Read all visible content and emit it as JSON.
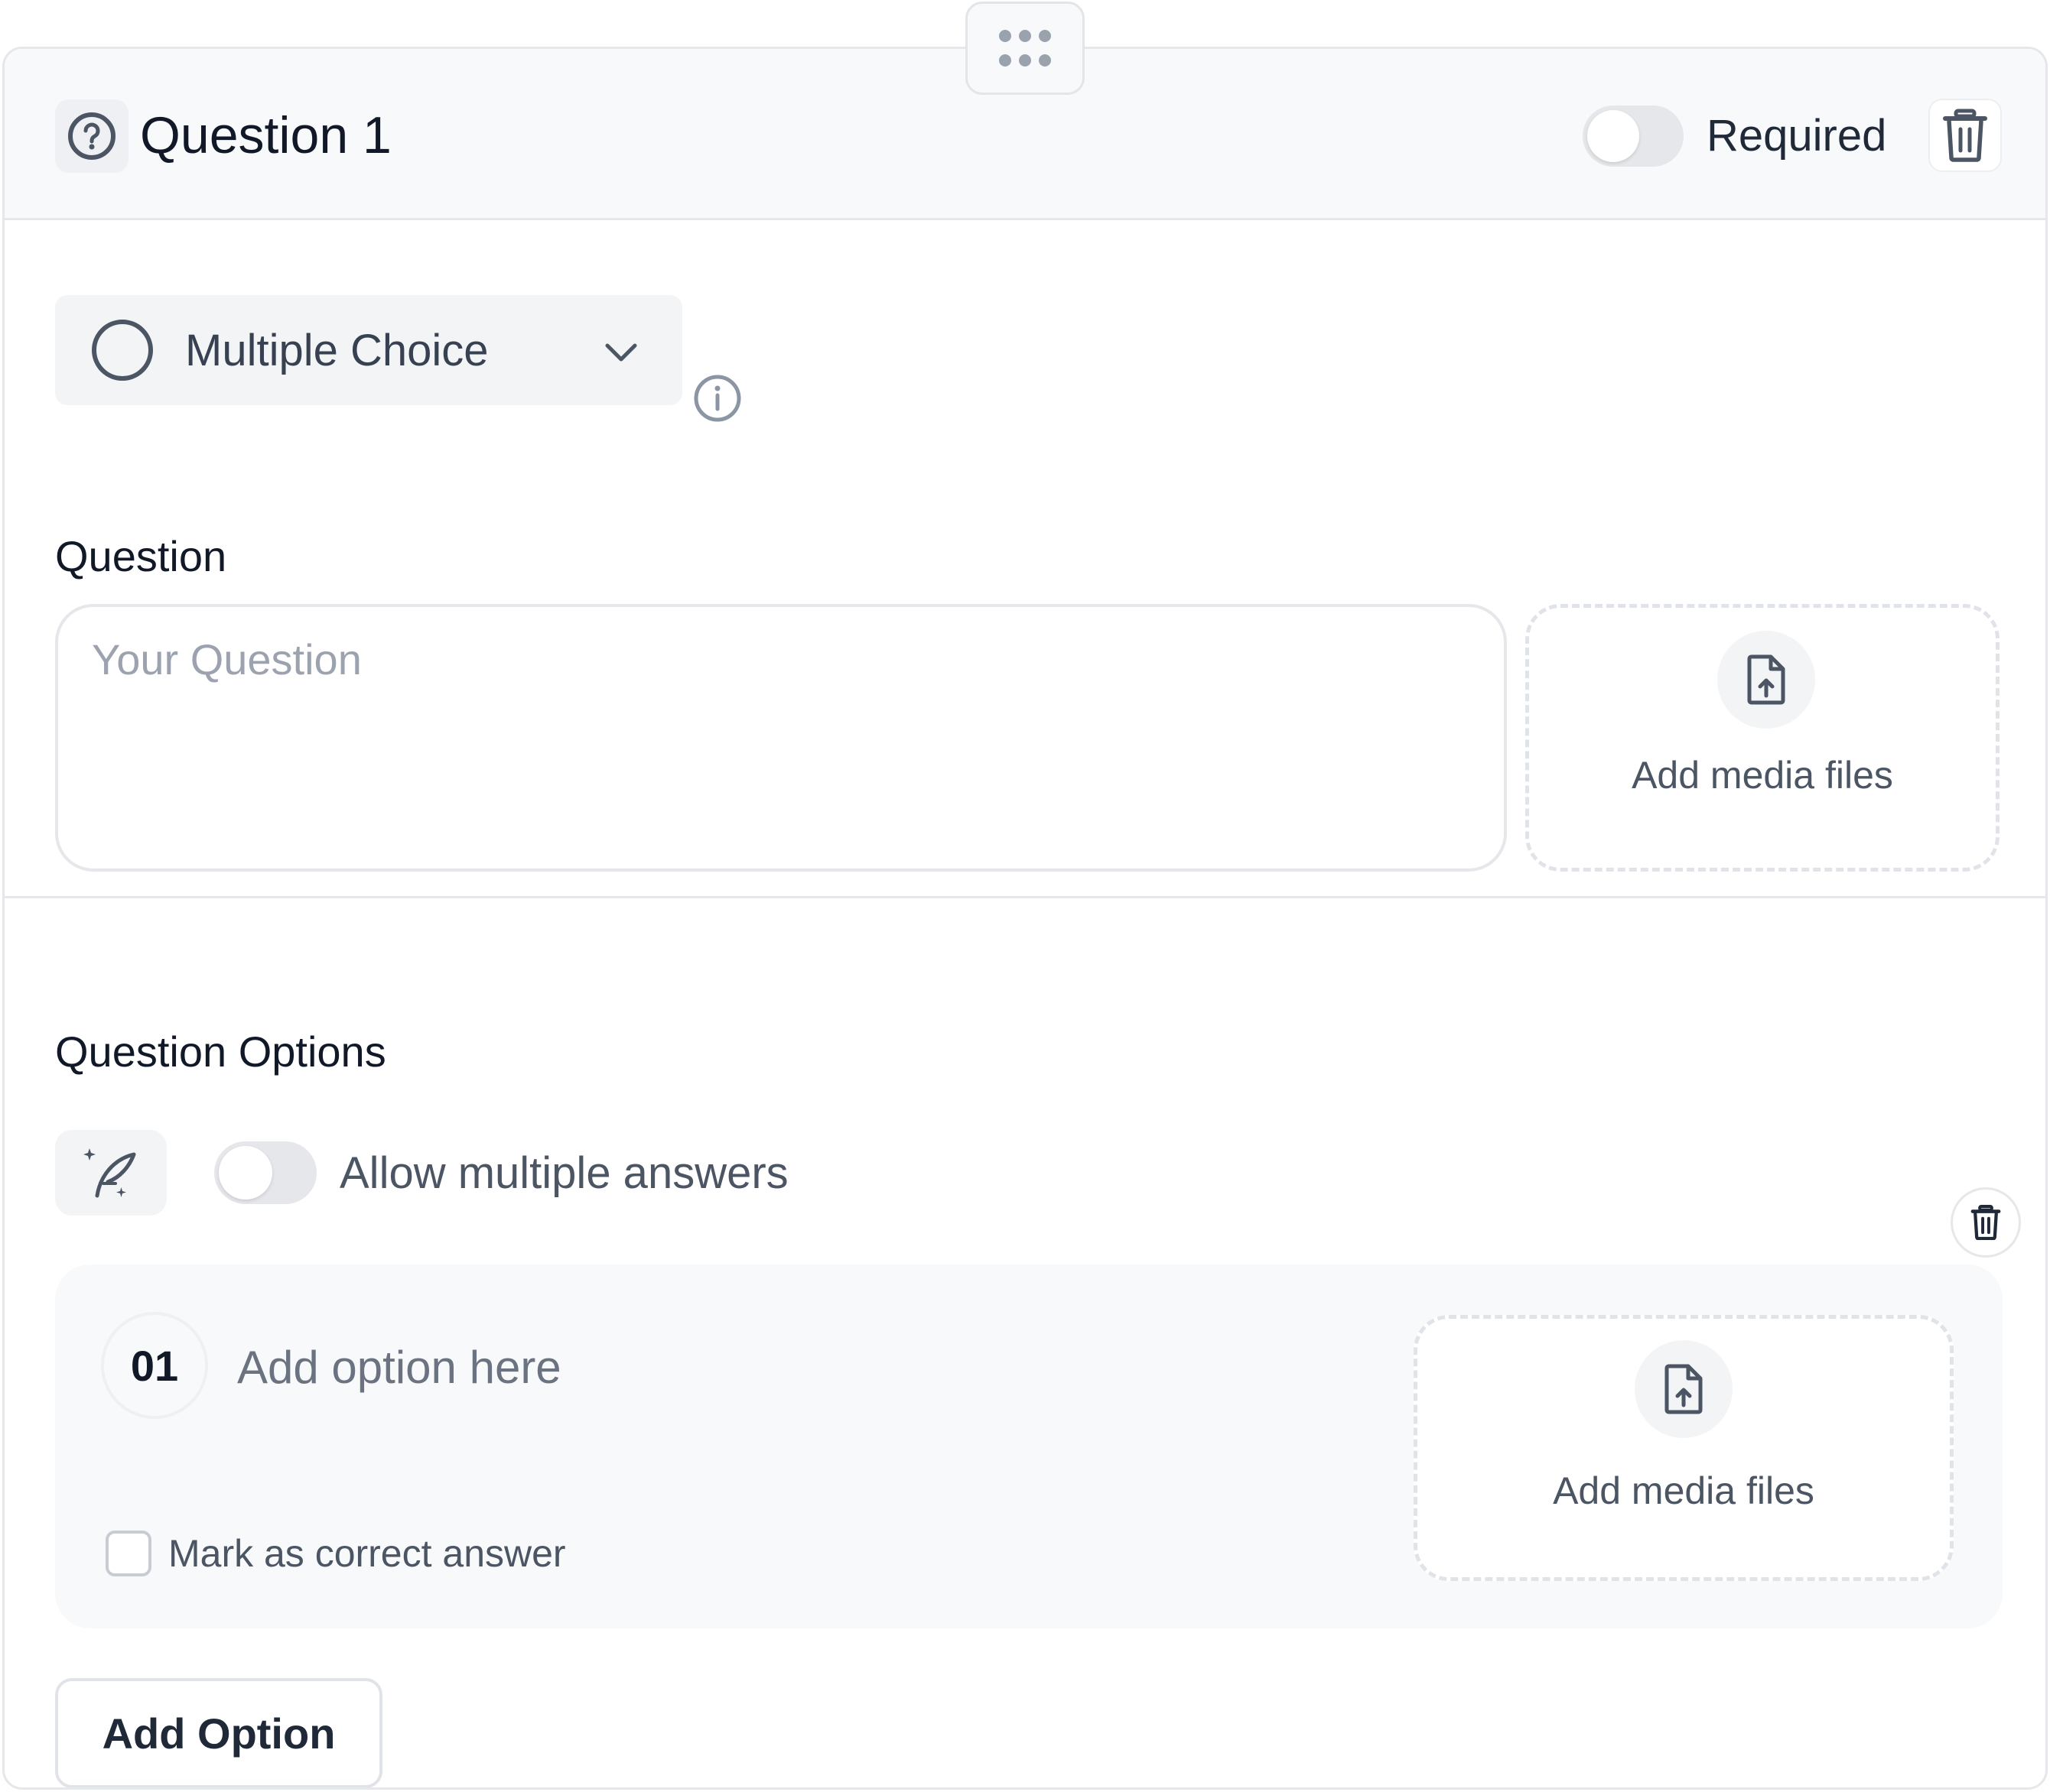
{
  "header": {
    "title": "Question 1",
    "required_label": "Required",
    "required_on": false
  },
  "question_type": {
    "selected": "Multiple Choice"
  },
  "question_section": {
    "label": "Question",
    "placeholder": "Your Question",
    "media_label": "Add media files"
  },
  "options_section": {
    "label": "Question Options",
    "multi_label": "Allow multiple answers",
    "multi_on": false,
    "options": [
      {
        "number": "01",
        "placeholder": "Add option here",
        "media_label": "Add media files",
        "correct_label": "Mark as correct answer",
        "correct": false
      }
    ],
    "add_label": "Add Option"
  },
  "icons": {
    "drag": "drag-handle-icon",
    "question": "question-circle-icon",
    "trash": "trash-icon",
    "radio": "radio-icon",
    "chevron": "chevron-down-icon",
    "info": "info-icon",
    "upload": "file-upload-icon",
    "ai": "magic-quill-icon"
  },
  "colors": {
    "toggle_off": "#e5e7eb",
    "border": "#e5e7eb",
    "muted_text": "#6b7280"
  }
}
